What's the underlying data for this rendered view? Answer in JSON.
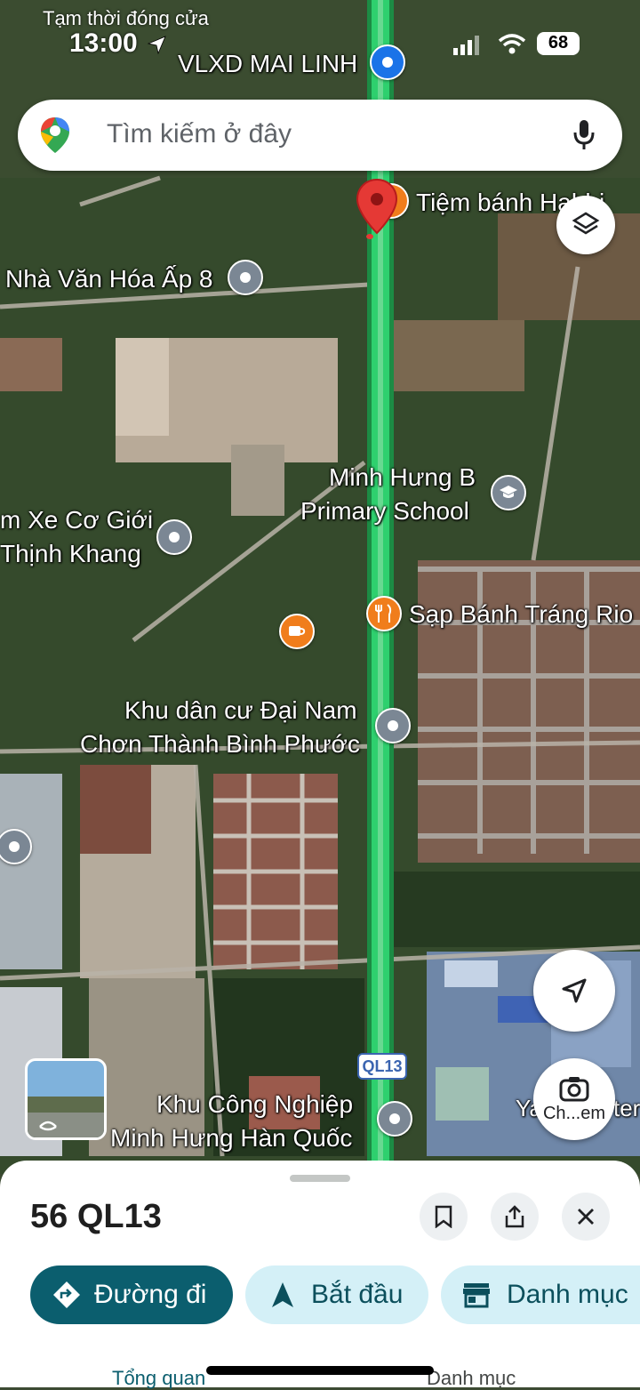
{
  "status_bar": {
    "notice": "Tạm thời đóng cửa",
    "time": "13:00",
    "battery": "68"
  },
  "search": {
    "placeholder": "Tìm kiếm ở đây"
  },
  "map_labels": {
    "vlxd": "VLXD MAI LINH",
    "tiem_banh": "Tiệm bánh Habbi",
    "nha_van_hoa": "Nhà Văn Hóa Ấp 8",
    "school_line1": "Minh Hưng B",
    "school_line2": "Primary School",
    "xe_line1": "m Xe Cơ Giới",
    "xe_line2": "Thịnh Khang",
    "sap_banh": "Sạp Bánh Tráng Rio",
    "khu_dan_cu_line1": "Khu dân cư Đại Nam",
    "khu_dan_cu_line2": "Chơn Thành Bình Phước",
    "khu_cn_line1": "Khu Công Nghiệp",
    "khu_cn_line2": "Minh Hưng Hàn Quốc",
    "road_shield": "QL13",
    "right_edge": "Ya",
    "right_edge2": "ter"
  },
  "lens_button": {
    "label": "Ch...em"
  },
  "sheet": {
    "title": "56 QL13",
    "chips": {
      "directions": "Đường đi",
      "start": "Bắt đầu",
      "catalog": "Danh mục"
    },
    "tabs": {
      "overview": "Tổng quan",
      "catalog": "Danh mục"
    }
  },
  "colors": {
    "primary_chip": "#0b5e6e",
    "secondary_chip": "#d4f0f7",
    "route": "#2ed06e",
    "pin_red": "#e53935"
  }
}
